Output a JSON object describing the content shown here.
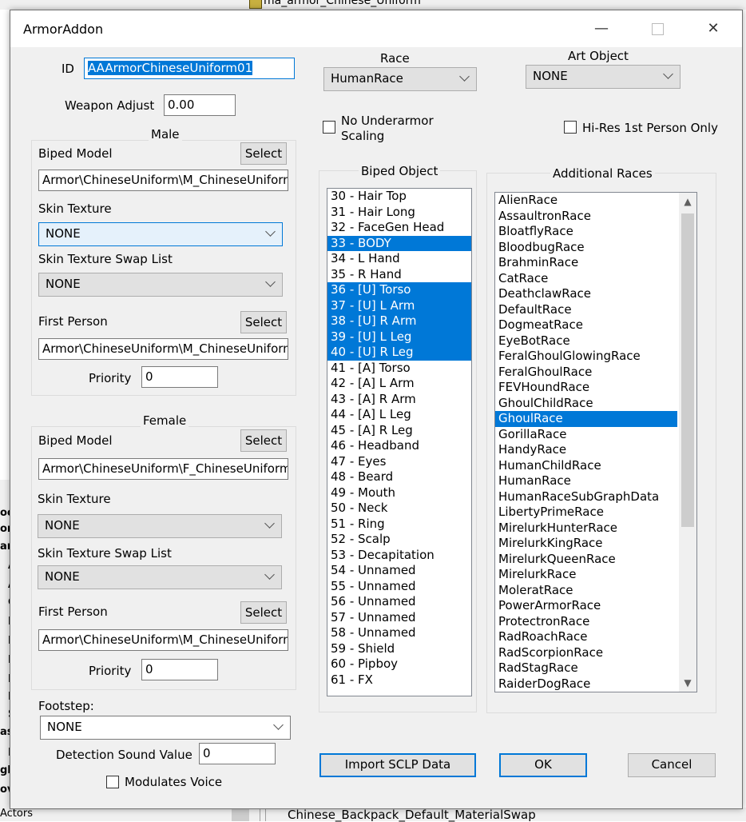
{
  "background": {
    "top_item": "ma_armor_Chinese_Uniform",
    "left_fragments": [
      "oo",
      "ora",
      "arm",
      "A",
      "A",
      "C",
      "F",
      "I",
      "L",
      "N",
      "F",
      "S",
      "as",
      "L",
      "gh",
      "ov"
    ],
    "bottom_left": "Actors",
    "bottom_item": "Chinese_Backpack_Default_MaterialSwap"
  },
  "window": {
    "title": "ArmorAddon",
    "minimize_glyph": "—",
    "close_glyph": "✕"
  },
  "fields": {
    "id_label": "ID",
    "id_value": "AAArmorChineseUniform01",
    "weapon_adjust_label": "Weapon Adjust",
    "weapon_adjust_value": "0.00",
    "race_label": "Race",
    "race_value": "HumanRace",
    "art_object_label": "Art Object",
    "art_object_value": "NONE",
    "no_underarmor_label_1": "No Underarmor",
    "no_underarmor_label_2": "Scaling",
    "hires_label": "Hi-Res 1st Person Only"
  },
  "male": {
    "group_label": "Male",
    "biped_model_label": "Biped Model",
    "select_label": "Select",
    "biped_model_value": "Armor\\ChineseUniform\\M_ChineseUniform_",
    "skin_texture_label": "Skin Texture",
    "skin_texture_value": "NONE",
    "swap_list_label": "Skin Texture Swap List",
    "swap_list_value": "NONE",
    "first_person_label": "First Person",
    "first_person_value": "Armor\\ChineseUniform\\M_ChineseUniform_",
    "priority_label": "Priority",
    "priority_value": "0"
  },
  "female": {
    "group_label": "Female",
    "biped_model_label": "Biped Model",
    "select_label": "Select",
    "biped_model_value": "Armor\\ChineseUniform\\F_ChineseUniform_",
    "skin_texture_label": "Skin Texture",
    "skin_texture_value": "NONE",
    "swap_list_label": "Skin Texture Swap List",
    "swap_list_value": "NONE",
    "first_person_label": "First Person",
    "first_person_value": "Armor\\ChineseUniform\\M_ChineseUniform_",
    "priority_label": "Priority",
    "priority_value": "0"
  },
  "footstep": {
    "label": "Footstep:",
    "value": "NONE",
    "detection_label": "Detection Sound Value",
    "detection_value": "0",
    "modulates_label": "Modulates Voice"
  },
  "biped_object": {
    "label": "Biped Object",
    "items": [
      {
        "text": "30 - Hair Top",
        "selected": false
      },
      {
        "text": "31 - Hair Long",
        "selected": false
      },
      {
        "text": "32 - FaceGen Head",
        "selected": false
      },
      {
        "text": "33 - BODY",
        "selected": true
      },
      {
        "text": "34 - L Hand",
        "selected": false
      },
      {
        "text": "35 - R Hand",
        "selected": false
      },
      {
        "text": "36 - [U] Torso",
        "selected": true
      },
      {
        "text": "37 - [U] L Arm",
        "selected": true
      },
      {
        "text": "38 - [U] R Arm",
        "selected": true
      },
      {
        "text": "39 - [U] L Leg",
        "selected": true
      },
      {
        "text": "40 - [U] R Leg",
        "selected": true
      },
      {
        "text": "41 - [A] Torso",
        "selected": false
      },
      {
        "text": "42 - [A] L Arm",
        "selected": false
      },
      {
        "text": "43 - [A] R Arm",
        "selected": false
      },
      {
        "text": "44 - [A] L Leg",
        "selected": false
      },
      {
        "text": "45 - [A] R Leg",
        "selected": false
      },
      {
        "text": "46 - Headband",
        "selected": false
      },
      {
        "text": "47 - Eyes",
        "selected": false
      },
      {
        "text": "48 - Beard",
        "selected": false
      },
      {
        "text": "49 - Mouth",
        "selected": false
      },
      {
        "text": "50 - Neck",
        "selected": false
      },
      {
        "text": "51 - Ring",
        "selected": false
      },
      {
        "text": "52 - Scalp",
        "selected": false
      },
      {
        "text": "53 - Decapitation",
        "selected": false
      },
      {
        "text": "54 - Unnamed",
        "selected": false
      },
      {
        "text": "55 - Unnamed",
        "selected": false
      },
      {
        "text": "56 - Unnamed",
        "selected": false
      },
      {
        "text": "57 - Unnamed",
        "selected": false
      },
      {
        "text": "58 - Unnamed",
        "selected": false
      },
      {
        "text": "59 - Shield",
        "selected": false
      },
      {
        "text": "60 - Pipboy",
        "selected": false
      },
      {
        "text": "61 - FX",
        "selected": false
      }
    ]
  },
  "additional_races": {
    "label": "Additional Races",
    "items": [
      {
        "text": "AlienRace",
        "selected": false
      },
      {
        "text": "AssaultronRace",
        "selected": false
      },
      {
        "text": "BloatflyRace",
        "selected": false
      },
      {
        "text": "BloodbugRace",
        "selected": false
      },
      {
        "text": "BrahminRace",
        "selected": false
      },
      {
        "text": "CatRace",
        "selected": false
      },
      {
        "text": "DeathclawRace",
        "selected": false
      },
      {
        "text": "DefaultRace",
        "selected": false
      },
      {
        "text": "DogmeatRace",
        "selected": false
      },
      {
        "text": "EyeBotRace",
        "selected": false
      },
      {
        "text": "FeralGhoulGlowingRace",
        "selected": false
      },
      {
        "text": "FeralGhoulRace",
        "selected": false
      },
      {
        "text": "FEVHoundRace",
        "selected": false
      },
      {
        "text": "GhoulChildRace",
        "selected": false
      },
      {
        "text": "GhoulRace",
        "selected": true
      },
      {
        "text": "GorillaRace",
        "selected": false
      },
      {
        "text": "HandyRace",
        "selected": false
      },
      {
        "text": "HumanChildRace",
        "selected": false
      },
      {
        "text": "HumanRace",
        "selected": false
      },
      {
        "text": "HumanRaceSubGraphData",
        "selected": false
      },
      {
        "text": "LibertyPrimeRace",
        "selected": false
      },
      {
        "text": "MirelurkHunterRace",
        "selected": false
      },
      {
        "text": "MirelurkKingRace",
        "selected": false
      },
      {
        "text": "MirelurkQueenRace",
        "selected": false
      },
      {
        "text": "MirelurkRace",
        "selected": false
      },
      {
        "text": "MoleratRace",
        "selected": false
      },
      {
        "text": "PowerArmorRace",
        "selected": false
      },
      {
        "text": "ProtectronRace",
        "selected": false
      },
      {
        "text": "RadRoachRace",
        "selected": false
      },
      {
        "text": "RadScorpionRace",
        "selected": false
      },
      {
        "text": "RadStagRace",
        "selected": false
      },
      {
        "text": "RaiderDogRace",
        "selected": false
      }
    ]
  },
  "buttons": {
    "import_label": "Import SCLP Data",
    "ok_label": "OK",
    "cancel_label": "Cancel"
  },
  "colors": {
    "selection": "#0078d7",
    "dialog_bg": "#f0f0f0"
  }
}
